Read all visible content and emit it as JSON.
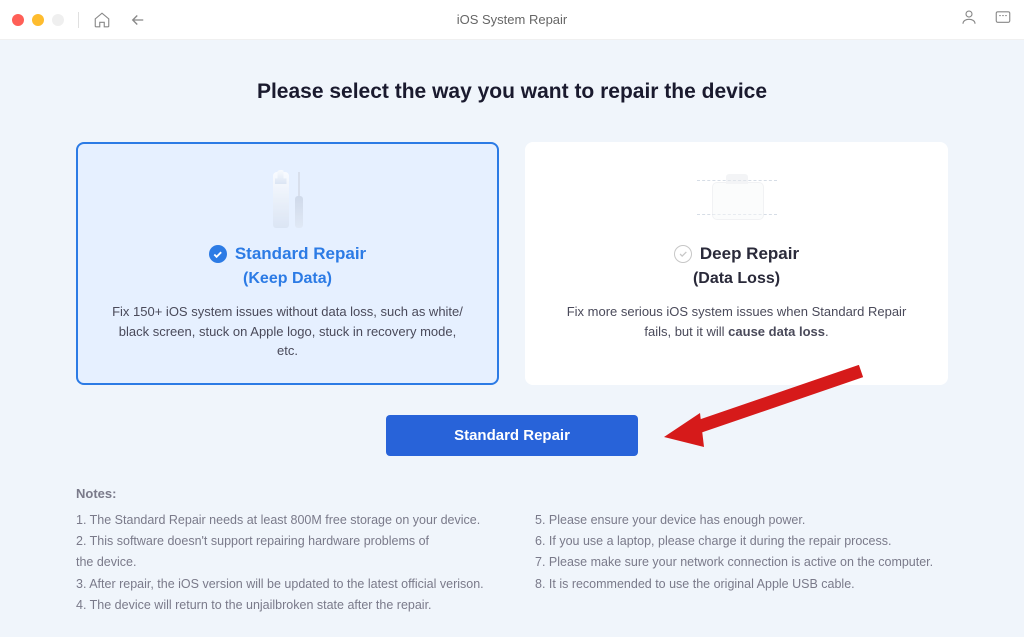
{
  "titlebar": {
    "title": "iOS System Repair"
  },
  "heading": "Please select the way you want to repair the device",
  "cards": {
    "standard": {
      "title": "Standard Repair",
      "subtitle": "(Keep Data)",
      "description_1": "Fix 150+ iOS system issues without data loss, such as white/",
      "description_2": "black screen, stuck on Apple logo, stuck in recovery mode,",
      "description_3": "etc."
    },
    "deep": {
      "title": "Deep Repair",
      "subtitle": "(Data Loss)",
      "description_1": "Fix more serious iOS system issues when Standard Repair",
      "description_2a": "fails, but it will ",
      "description_2b": "cause data loss"
    }
  },
  "action_button": "Standard Repair",
  "notes": {
    "heading": "Notes:",
    "left": [
      "1. The Standard Repair needs at least 800M free storage on your device.",
      "2. This software doesn't support repairing hardware problems of",
      "the device.",
      "3. After repair, the iOS version will be updated to the latest official verison.",
      "4. The device will return to the unjailbroken state after the repair."
    ],
    "right": [
      "5. Please ensure your device has enough power.",
      "6. If you use a laptop, please charge it during the repair process.",
      "7. Please make sure your network connection is active on the computer.",
      "8. It is recommended to use the original Apple USB cable."
    ]
  }
}
